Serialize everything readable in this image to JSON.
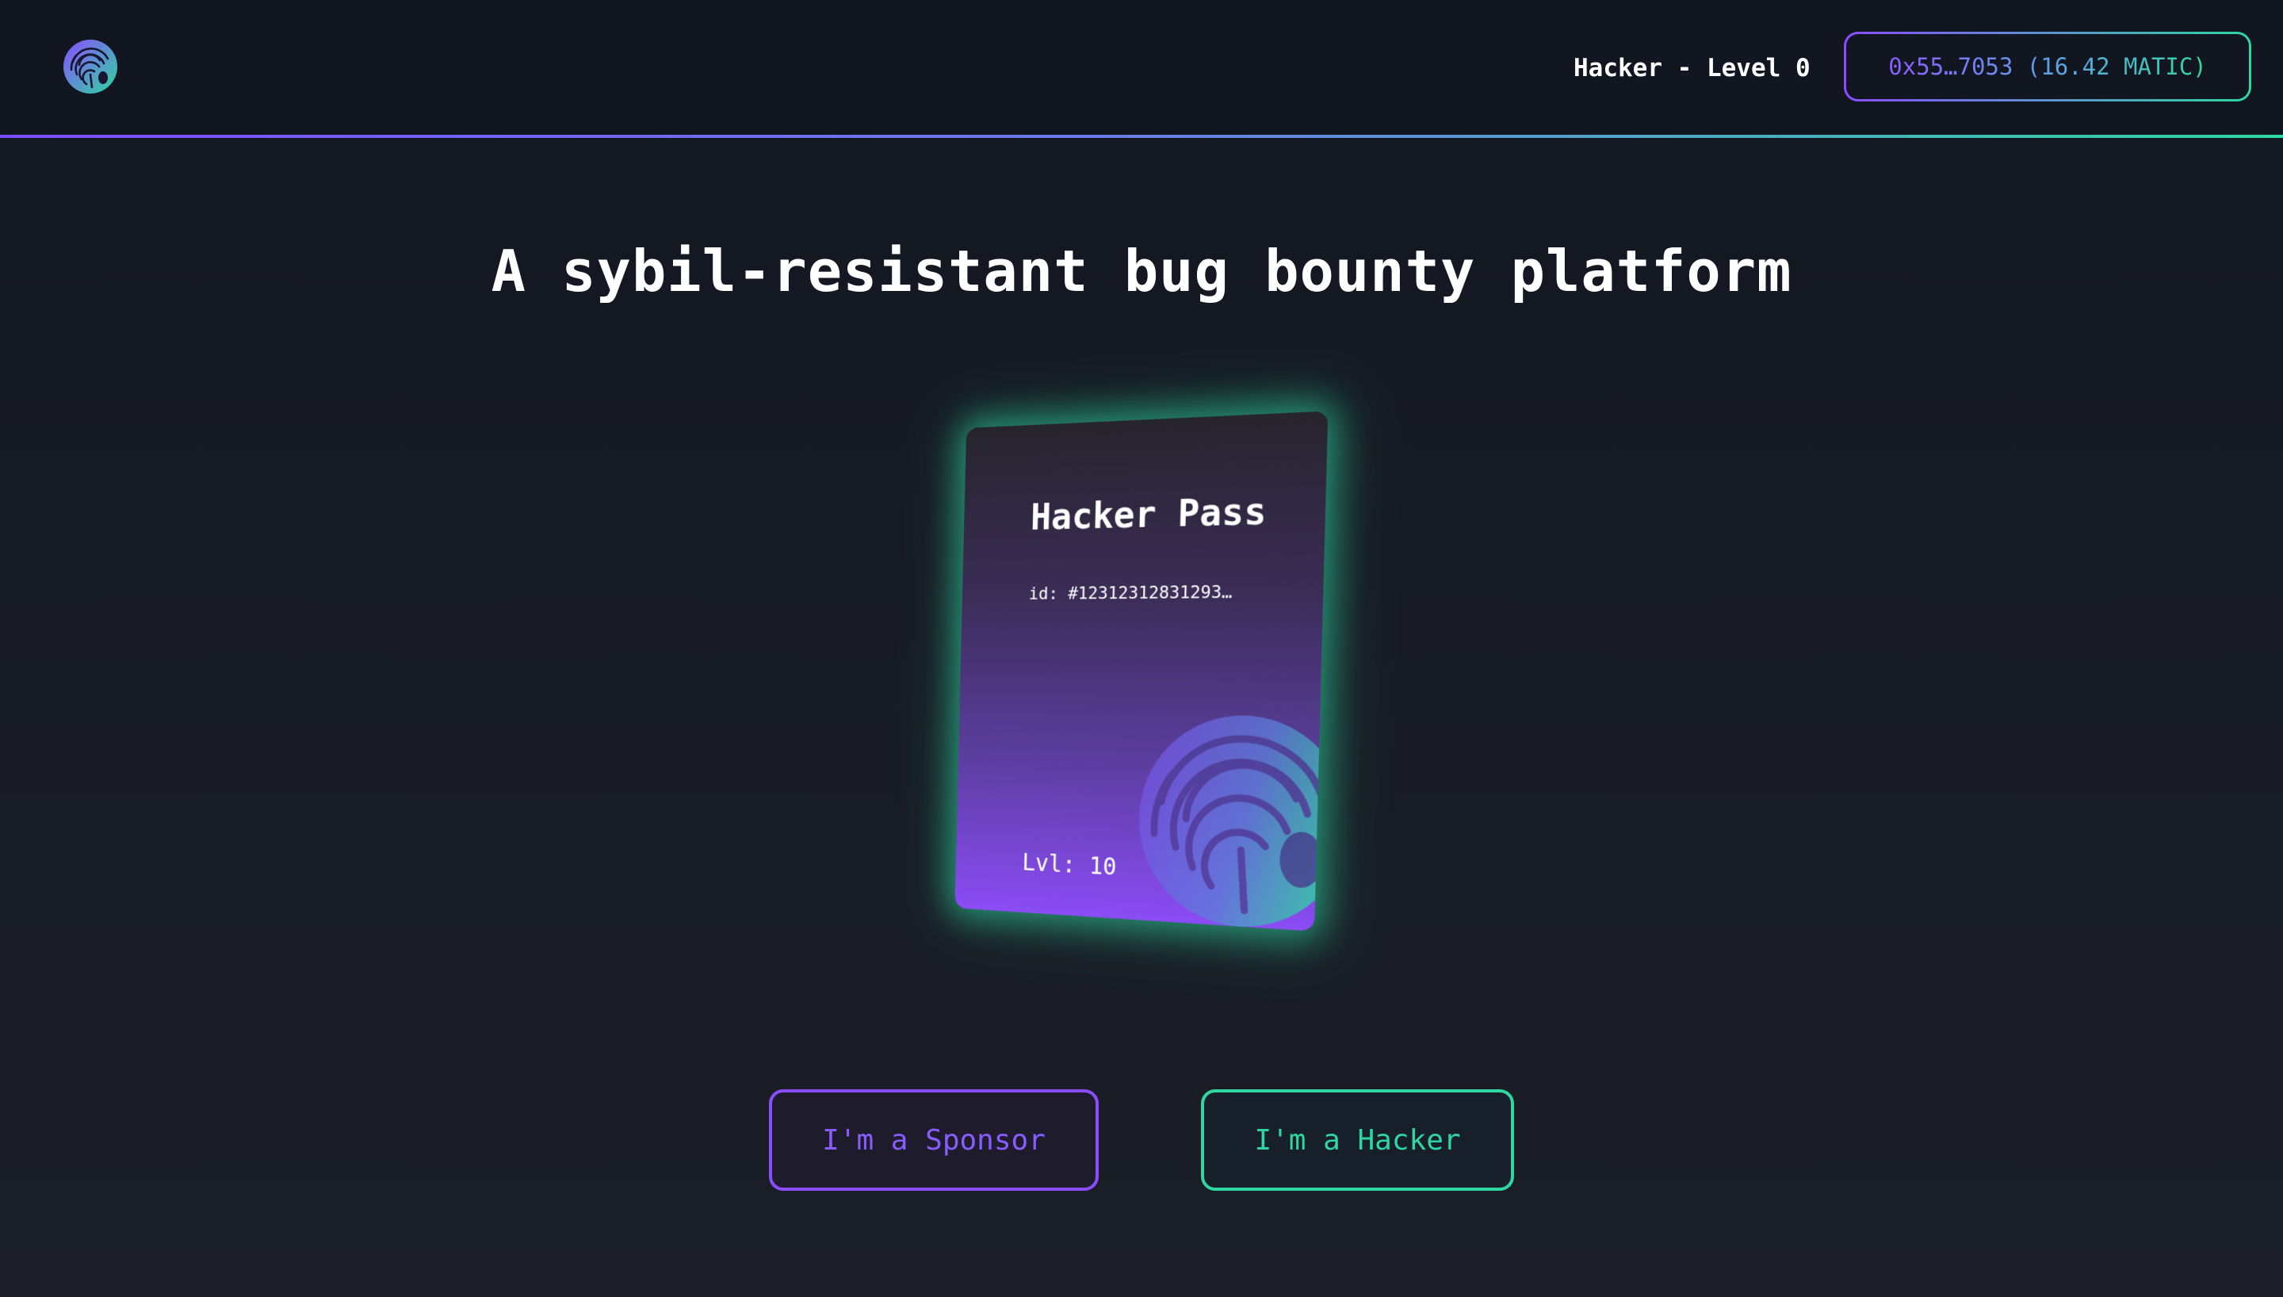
{
  "header": {
    "logo_icon": "fingerprint-bug-logo-icon",
    "level_label": "Hacker - Level 0",
    "wallet_button_label": "0x55…7053 (16.42 MATIC)"
  },
  "hero": {
    "title": "A sybil-resistant bug bounty platform"
  },
  "card": {
    "title": "Hacker Pass",
    "id_label": "id: #12312312831293…",
    "level_label": "Lvl: 10",
    "emblem_icon": "fingerprint-bug-icon"
  },
  "actions": {
    "sponsor_label": "I'm a Sponsor",
    "hacker_label": "I'm a Hacker"
  },
  "colors": {
    "purple": "#8a4dff",
    "green": "#2fd6a0",
    "background": "#131720"
  }
}
